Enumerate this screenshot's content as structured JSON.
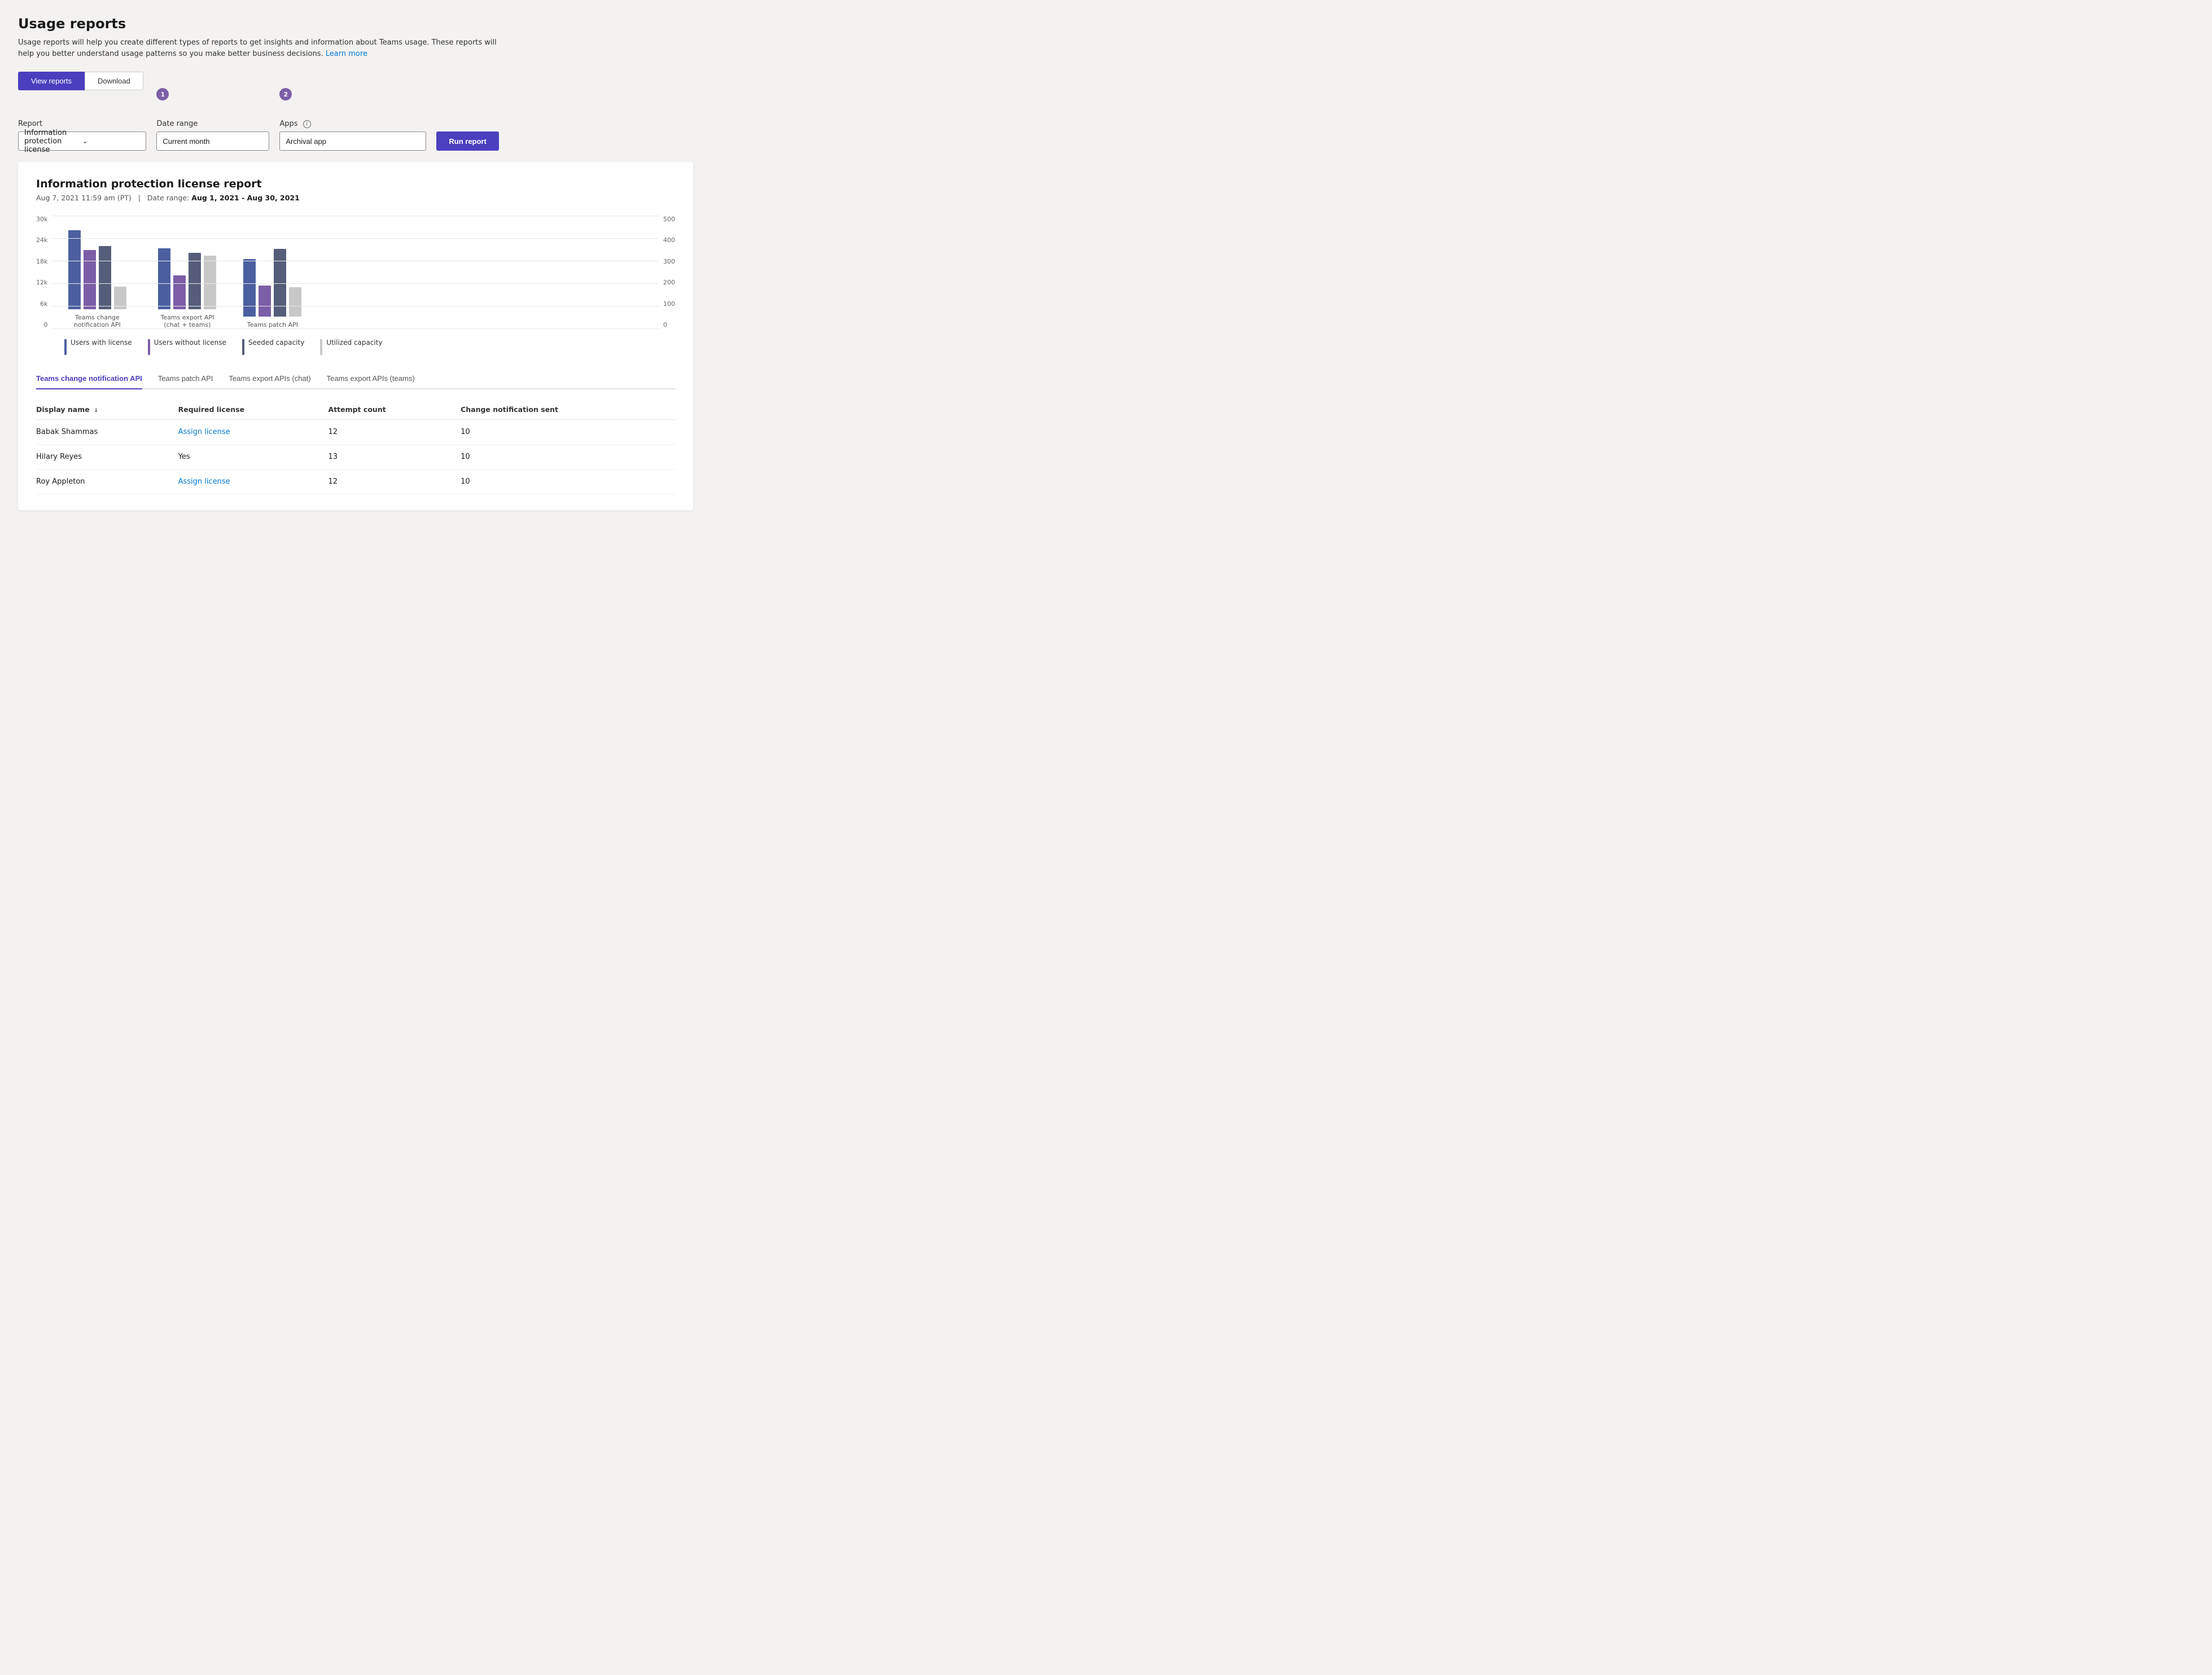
{
  "page": {
    "title": "Usage reports",
    "description": "Usage reports will help you create different types of reports to get insights and information about Teams usage. These reports will help you better understand usage patterns so you make better business decisions.",
    "learn_more_text": "Learn more",
    "tabs": [
      {
        "label": "View reports",
        "active": true
      },
      {
        "label": "Download",
        "active": false
      }
    ]
  },
  "controls": {
    "report_label": "Report",
    "report_value": "Information protection license",
    "report_placeholder": "Information protection license",
    "date_range_label": "Date range",
    "date_range_step": "1",
    "date_range_value": "Current month",
    "apps_label": "Apps",
    "apps_step": "2",
    "apps_value": "Archival app",
    "apps_info": "i",
    "run_report_label": "Run report"
  },
  "report": {
    "title": "Information protection license report",
    "date": "Aug 7, 2021",
    "time": "11:59 am (PT)",
    "date_range_label": "Date range:",
    "date_range_value": "Aug 1, 2021 - Aug 30, 2021",
    "chart": {
      "y_left": [
        "30k",
        "24k",
        "18k",
        "12k",
        "6k",
        "0"
      ],
      "y_right": [
        "500",
        "400",
        "300",
        "200",
        "100",
        "0"
      ],
      "groups": [
        {
          "label": "Teams change notification API",
          "bars": [
            {
              "type": "blue",
              "height": 140
            },
            {
              "type": "purple",
              "height": 105
            },
            {
              "type": "dark",
              "height": 112
            },
            {
              "type": "light",
              "height": 40
            }
          ]
        },
        {
          "label": "Teams export API\n(chat + teams)",
          "bars": [
            {
              "type": "blue",
              "height": 108
            },
            {
              "type": "purple",
              "height": 60
            },
            {
              "type": "dark",
              "height": 100
            },
            {
              "type": "light",
              "height": 95
            }
          ]
        },
        {
          "label": "Teams patch API",
          "bars": [
            {
              "type": "blue",
              "height": 102
            },
            {
              "type": "purple",
              "height": 55
            },
            {
              "type": "dark",
              "height": 120
            },
            {
              "type": "light",
              "height": 52
            }
          ]
        }
      ],
      "legend": [
        {
          "color": "blue",
          "label": "Users with license"
        },
        {
          "color": "purple",
          "label": "Users without license"
        },
        {
          "color": "dark",
          "label": "Seeded capacity"
        },
        {
          "color": "light",
          "label": "Utilized capacity"
        }
      ]
    },
    "data_tabs": [
      {
        "label": "Teams change notification API",
        "active": true
      },
      {
        "label": "Teams patch API",
        "active": false
      },
      {
        "label": "Teams export APIs (chat)",
        "active": false
      },
      {
        "label": "Teams export APIs (teams)",
        "active": false
      }
    ],
    "table": {
      "columns": [
        {
          "header": "Display name",
          "sortable": true
        },
        {
          "header": "Required license",
          "sortable": false
        },
        {
          "header": "Attempt count",
          "sortable": false
        },
        {
          "header": "Change notification sent",
          "sortable": false
        }
      ],
      "rows": [
        {
          "name": "Babak Shammas",
          "license": "Assign license",
          "license_link": true,
          "attempt": "12",
          "notification": "10"
        },
        {
          "name": "Hilary Reyes",
          "license": "Yes",
          "license_link": false,
          "attempt": "13",
          "notification": "10"
        },
        {
          "name": "Roy Appleton",
          "license": "Assign license",
          "license_link": true,
          "attempt": "12",
          "notification": "10"
        }
      ]
    }
  }
}
